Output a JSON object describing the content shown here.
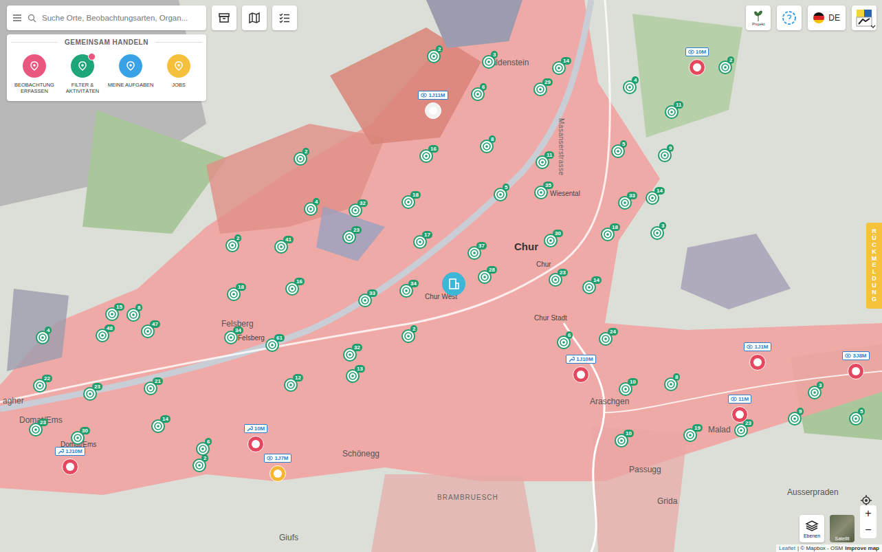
{
  "search": {
    "placeholder": "Suche Orte, Beobachtungsarten, Organ..."
  },
  "panel": {
    "title": "GEMEINSAM HANDELN",
    "actions": [
      {
        "label": "BEOBACHTUNG ERFASSEN",
        "color": "#e9577f",
        "badge": false
      },
      {
        "label": "FILTER & AKTIVITÄTEN",
        "color": "#1ea57a",
        "badge": true
      },
      {
        "label": "MEINE AUFGABEN",
        "color": "#39a2e6",
        "badge": false
      },
      {
        "label": "JOBS",
        "color": "#f5c13d",
        "badge": false
      }
    ]
  },
  "header": {
    "project": "Projekt",
    "language": "DE"
  },
  "feedback": "RÜCKMELDUNG",
  "controls": {
    "layers": "Ebenen",
    "satellite": "Satellit",
    "zoom_in": "+",
    "zoom_out": "−"
  },
  "attribution": {
    "leaflet": "Leaflet",
    "rest": "| © Mapbox - OSM",
    "improve": "Improve map"
  },
  "places": [
    {
      "name": "Haldenstein",
      "kind": "town"
    },
    {
      "name": "Masanserstrasse",
      "kind": "road"
    },
    {
      "name": "Wiesental",
      "kind": "small"
    },
    {
      "name": "Chur",
      "kind": "city"
    },
    {
      "name": "Chur",
      "kind": "small"
    },
    {
      "name": "Chur West",
      "kind": "small"
    },
    {
      "name": "Chur Stadt",
      "kind": "small"
    },
    {
      "name": "Felsberg",
      "kind": "town"
    },
    {
      "name": "Felsberg",
      "kind": "small"
    },
    {
      "name": "Domat/Ems",
      "kind": "town"
    },
    {
      "name": "Domat/Ems",
      "kind": "small"
    },
    {
      "name": "agher",
      "kind": "town"
    },
    {
      "name": "Schönegg",
      "kind": "town"
    },
    {
      "name": "Araschgen",
      "kind": "town"
    },
    {
      "name": "Passugg",
      "kind": "town"
    },
    {
      "name": "Malad",
      "kind": "town"
    },
    {
      "name": "BRAMBRUESCH",
      "kind": "area"
    },
    {
      "name": "Grida",
      "kind": "town"
    },
    {
      "name": "Ausserpraden",
      "kind": "town"
    },
    {
      "name": "Giufs",
      "kind": "town"
    }
  ],
  "clusters": [
    "2",
    "3",
    "14",
    "29",
    "6",
    "4",
    "2",
    "11",
    "2",
    "16",
    "8",
    "11",
    "5",
    "9",
    "5",
    "35",
    "33",
    "14",
    "4",
    "32",
    "18",
    "2",
    "41",
    "23",
    "17",
    "37",
    "30",
    "18",
    "3",
    "18",
    "16",
    "33",
    "34",
    "28",
    "23",
    "14",
    "15",
    "8",
    "47",
    "48",
    "4",
    "34",
    "61",
    "2",
    "32",
    "13",
    "6",
    "24",
    "22",
    "23",
    "21",
    "12",
    "10",
    "8",
    "3",
    "14",
    "23",
    "30",
    "6",
    "2",
    "10",
    "19",
    "23",
    "9",
    "5"
  ],
  "observations": [
    {
      "age": "1J11M",
      "kind": "eye",
      "color": "#f2f2f2"
    },
    {
      "age": "10M",
      "kind": "eye",
      "color": "#e4475e"
    },
    {
      "age": "1J10M",
      "kind": "tool",
      "color": "#e4475e"
    },
    {
      "age": "1J1M",
      "kind": "eye",
      "color": "#e4475e"
    },
    {
      "age": "3J8M",
      "kind": "eye",
      "color": "#e4475e"
    },
    {
      "age": "11M",
      "kind": "eye",
      "color": "#e4475e"
    },
    {
      "age": "10M",
      "kind": "tool",
      "color": "#e4475e"
    },
    {
      "age": "1J7M",
      "kind": "eye",
      "color": "#f5b731"
    },
    {
      "age": "1J10M",
      "kind": "tool",
      "color": "#e4475e"
    }
  ]
}
